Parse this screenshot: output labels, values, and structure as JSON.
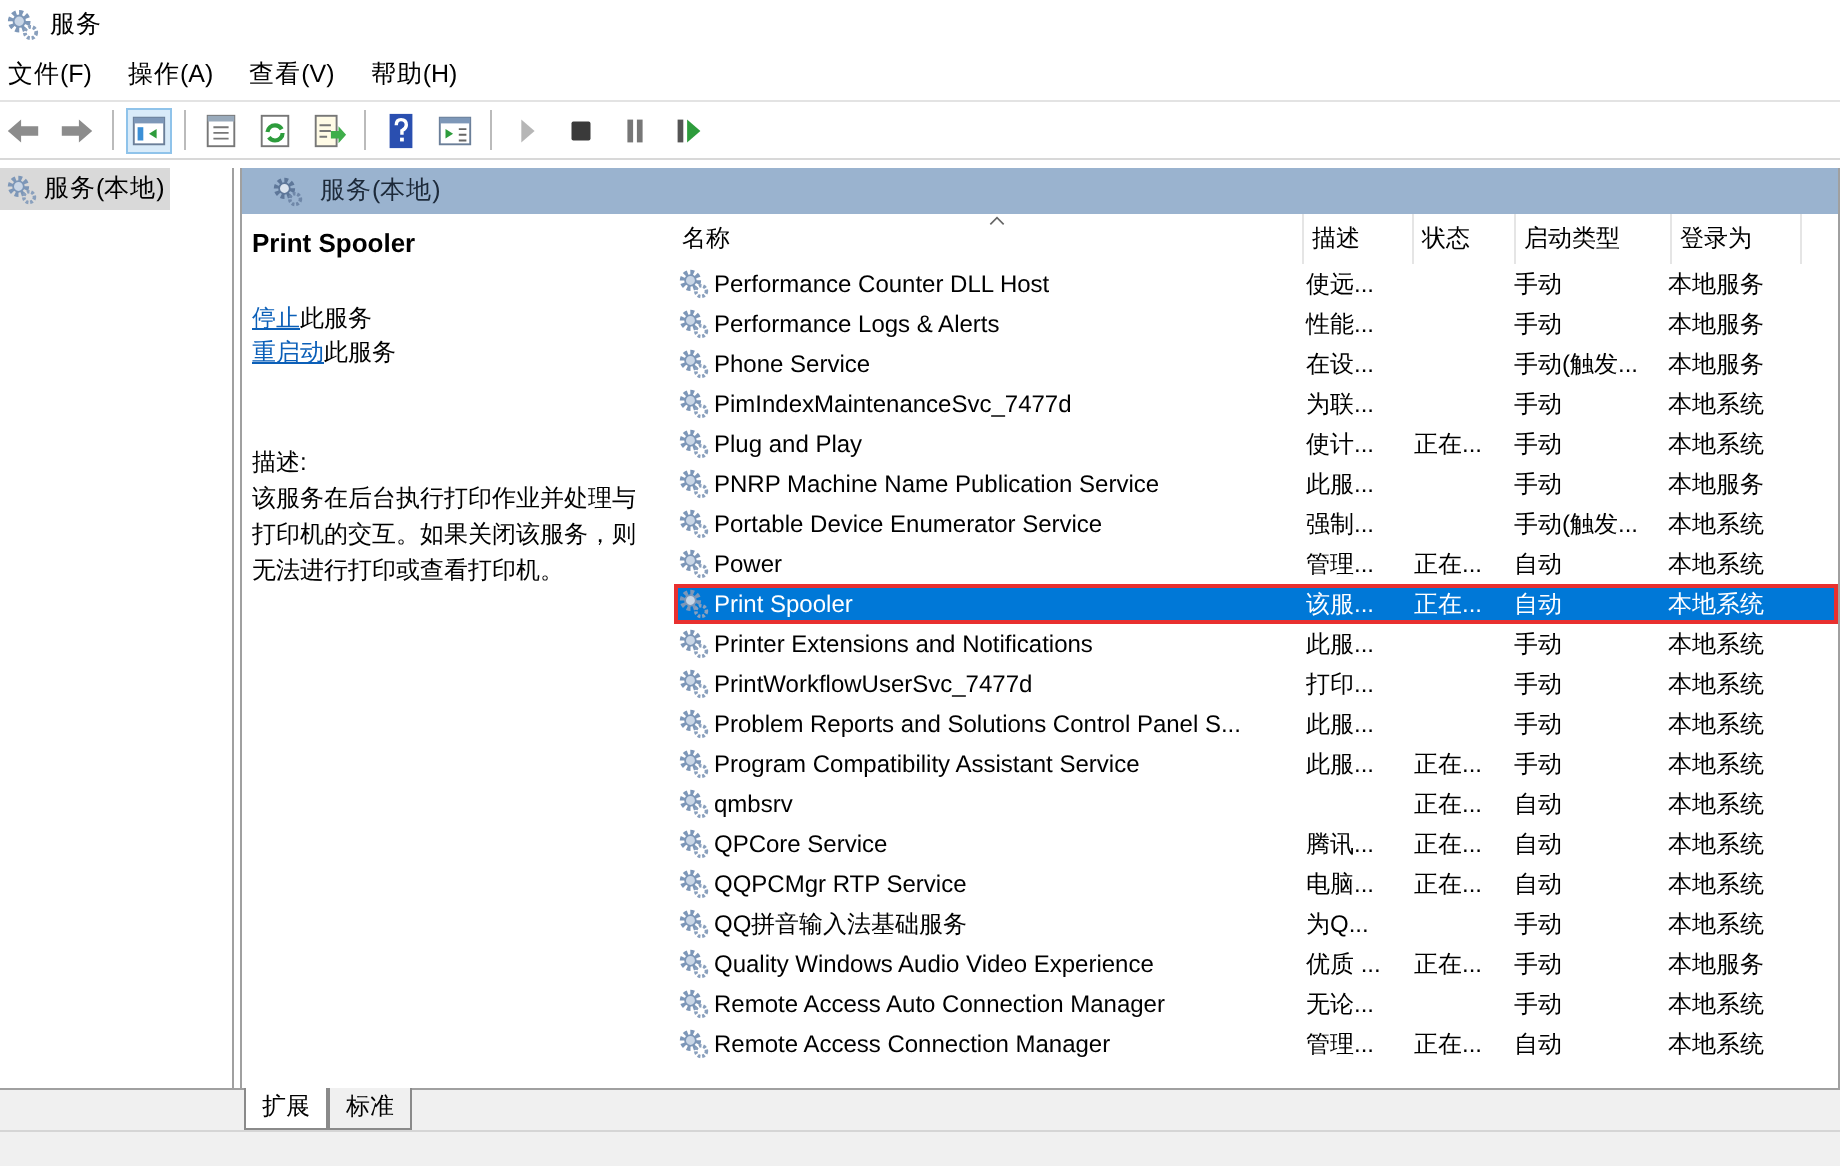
{
  "window": {
    "title": "服务"
  },
  "menu": [
    "文件(F)",
    "操作(A)",
    "查看(V)",
    "帮助(H)"
  ],
  "toolbar": [
    {
      "kind": "back",
      "selected": false,
      "disabled": false
    },
    {
      "kind": "forward",
      "selected": false,
      "disabled": false
    },
    {
      "kind": "tree",
      "selected": true,
      "disabled": false
    },
    {
      "kind": "properties",
      "selected": false,
      "disabled": false
    },
    {
      "kind": "refresh",
      "selected": false,
      "disabled": false
    },
    {
      "kind": "export",
      "selected": false,
      "disabled": false
    },
    {
      "kind": "help",
      "selected": false,
      "disabled": false
    },
    {
      "kind": "console",
      "selected": false,
      "disabled": false
    },
    {
      "kind": "start",
      "selected": false,
      "disabled": true
    },
    {
      "kind": "stop",
      "selected": false,
      "disabled": false
    },
    {
      "kind": "pause",
      "selected": false,
      "disabled": false
    },
    {
      "kind": "resume",
      "selected": false,
      "disabled": false
    }
  ],
  "tree": {
    "items": [
      {
        "label": "服务(本地)",
        "selected": true
      }
    ]
  },
  "panel": {
    "title": "服务(本地)"
  },
  "details": {
    "service_name": "Print Spooler",
    "actions": [
      {
        "link": "停止",
        "text": "此服务"
      },
      {
        "link": "重启动",
        "text": "此服务"
      }
    ],
    "description_label": "描述:",
    "description": "该服务在后台执行打印作业并处理与打印机的交互。如果关闭该服务，则无法进行打印或查看打印机。"
  },
  "table": {
    "columns": [
      {
        "label": "名称",
        "sorted": true
      },
      {
        "label": "描述",
        "sorted": false
      },
      {
        "label": "状态",
        "sorted": false
      },
      {
        "label": "启动类型",
        "sorted": false
      },
      {
        "label": "登录为",
        "sorted": false
      }
    ],
    "rows": [
      {
        "name": "Performance Counter DLL Host",
        "description": "使远...",
        "status": "",
        "startup": "手动",
        "logon": "本地服务",
        "selected": false,
        "outlined": false
      },
      {
        "name": "Performance Logs & Alerts",
        "description": "性能...",
        "status": "",
        "startup": "手动",
        "logon": "本地服务",
        "selected": false,
        "outlined": false
      },
      {
        "name": "Phone Service",
        "description": "在设...",
        "status": "",
        "startup": "手动(触发...",
        "logon": "本地服务",
        "selected": false,
        "outlined": false
      },
      {
        "name": "PimIndexMaintenanceSvc_7477d",
        "description": "为联...",
        "status": "",
        "startup": "手动",
        "logon": "本地系统",
        "selected": false,
        "outlined": false
      },
      {
        "name": "Plug and Play",
        "description": "使计...",
        "status": "正在...",
        "startup": "手动",
        "logon": "本地系统",
        "selected": false,
        "outlined": false
      },
      {
        "name": "PNRP Machine Name Publication Service",
        "description": "此服...",
        "status": "",
        "startup": "手动",
        "logon": "本地服务",
        "selected": false,
        "outlined": false
      },
      {
        "name": "Portable Device Enumerator Service",
        "description": "强制...",
        "status": "",
        "startup": "手动(触发...",
        "logon": "本地系统",
        "selected": false,
        "outlined": false
      },
      {
        "name": "Power",
        "description": "管理...",
        "status": "正在...",
        "startup": "自动",
        "logon": "本地系统",
        "selected": false,
        "outlined": false
      },
      {
        "name": "Print Spooler",
        "description": "该服...",
        "status": "正在...",
        "startup": "自动",
        "logon": "本地系统",
        "selected": true,
        "outlined": true
      },
      {
        "name": "Printer Extensions and Notifications",
        "description": "此服...",
        "status": "",
        "startup": "手动",
        "logon": "本地系统",
        "selected": false,
        "outlined": false
      },
      {
        "name": "PrintWorkflowUserSvc_7477d",
        "description": "打印...",
        "status": "",
        "startup": "手动",
        "logon": "本地系统",
        "selected": false,
        "outlined": false
      },
      {
        "name": "Problem Reports and Solutions Control Panel S...",
        "description": "此服...",
        "status": "",
        "startup": "手动",
        "logon": "本地系统",
        "selected": false,
        "outlined": false
      },
      {
        "name": "Program Compatibility Assistant Service",
        "description": "此服...",
        "status": "正在...",
        "startup": "手动",
        "logon": "本地系统",
        "selected": false,
        "outlined": false
      },
      {
        "name": "qmbsrv",
        "description": "",
        "status": "正在...",
        "startup": "自动",
        "logon": "本地系统",
        "selected": false,
        "outlined": false
      },
      {
        "name": "QPCore Service",
        "description": "腾讯...",
        "status": "正在...",
        "startup": "自动",
        "logon": "本地系统",
        "selected": false,
        "outlined": false
      },
      {
        "name": "QQPCMgr RTP Service",
        "description": "电脑...",
        "status": "正在...",
        "startup": "自动",
        "logon": "本地系统",
        "selected": false,
        "outlined": false
      },
      {
        "name": "QQ拼音输入法基础服务",
        "description": "为Q...",
        "status": "",
        "startup": "手动",
        "logon": "本地系统",
        "selected": false,
        "outlined": false
      },
      {
        "name": "Quality Windows Audio Video Experience",
        "description": "优质 ...",
        "status": "正在...",
        "startup": "手动",
        "logon": "本地服务",
        "selected": false,
        "outlined": false
      },
      {
        "name": "Remote Access Auto Connection Manager",
        "description": "无论...",
        "status": "",
        "startup": "手动",
        "logon": "本地系统",
        "selected": false,
        "outlined": false
      },
      {
        "name": "Remote Access Connection Manager",
        "description": "管理...",
        "status": "正在...",
        "startup": "自动",
        "logon": "本地系统",
        "selected": false,
        "outlined": false
      }
    ]
  },
  "view_tabs": [
    {
      "label": "扩展",
      "selected": true
    },
    {
      "label": "标准",
      "selected": false
    }
  ]
}
